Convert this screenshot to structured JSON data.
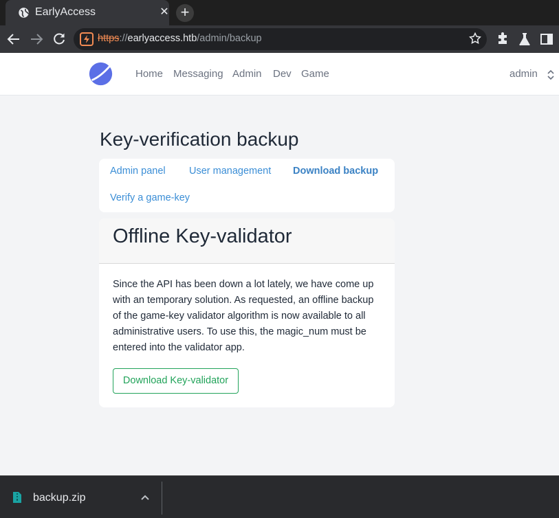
{
  "browser": {
    "tab_title": "EarlyAccess",
    "tab_close": "✕",
    "new_tab": "+",
    "url_scheme": "https",
    "url_separator": "://",
    "url_host": "earlyaccess.htb",
    "url_path": "/admin/backup"
  },
  "navbar": {
    "links": [
      "Home",
      "Messaging",
      "Admin",
      "Dev",
      "Game"
    ],
    "user": "admin"
  },
  "page": {
    "title": "Key-verification backup",
    "subnav": [
      "Admin panel",
      "User management",
      "Download backup",
      "Verify a game-key"
    ],
    "active_subnav": "Download backup"
  },
  "card": {
    "title": "Offline Key-validator",
    "body": "Since the API has been down a lot lately, we have come up with an temporary solution. As requested, an offline backup of the game-key validator algorithm is now available to all administrative users. To use this, the magic_num must be entered into the validator app.",
    "button": "Download Key-validator"
  },
  "downloads": {
    "file_name": "backup.zip"
  },
  "colors": {
    "link": "#3b8ed6",
    "success": "#22a35a",
    "warning": "#f28b53"
  },
  "icons": [
    "globe-icon",
    "back-arrow-icon",
    "forward-arrow-icon",
    "reload-icon",
    "insecure-warning-icon",
    "star-icon",
    "extensions-icon",
    "lab-flask-icon",
    "sidebar-icon",
    "site-logo",
    "sort-caret-icon",
    "zip-file-icon",
    "chevron-up-icon"
  ]
}
